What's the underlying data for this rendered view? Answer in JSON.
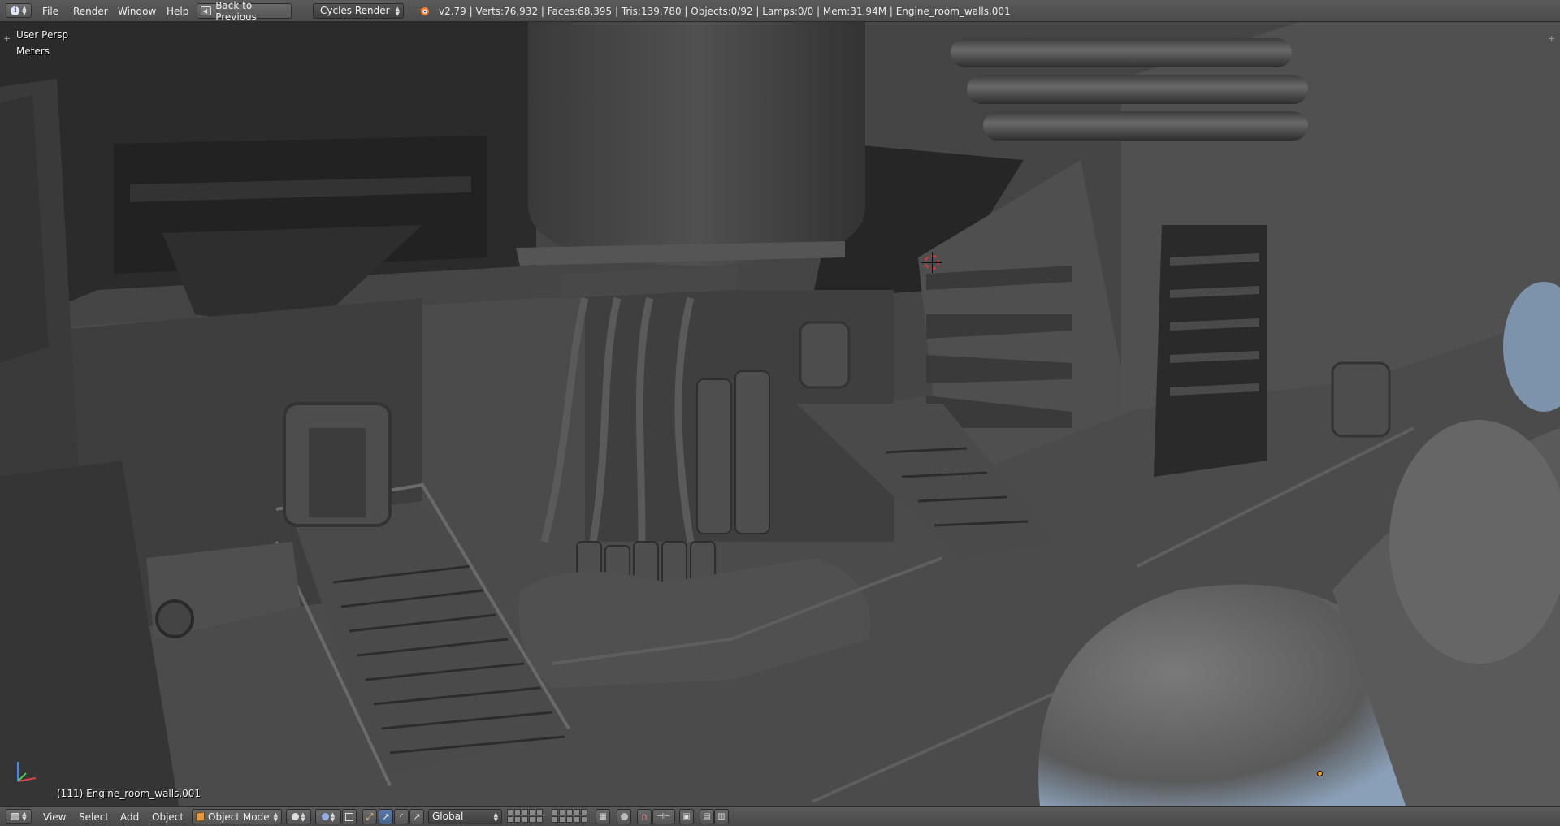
{
  "topbar": {
    "menus": [
      "File",
      "Render",
      "Window",
      "Help"
    ],
    "back_button": "Back to Previous",
    "render_engine": "Cycles Render",
    "stats": "v2.79 | Verts:76,932 | Faces:68,395 | Tris:139,780 | Objects:0/92 | Lamps:0/0 | Mem:31.94M | Engine_room_walls.001"
  },
  "viewport": {
    "view_name": "User Persp",
    "units": "Meters",
    "active_object": "(111) Engine_room_walls.001"
  },
  "bottombar": {
    "menus": [
      "View",
      "Select",
      "Add",
      "Object"
    ],
    "mode": "Object Mode",
    "orientation": "Global"
  },
  "icons": {
    "editor_type": "info-icon",
    "logo": "blender-logo-icon",
    "cursor": "3d-cursor-icon",
    "origin": "object-origin-icon"
  },
  "colors": {
    "header": "#4c4c4c",
    "viewport": "#454545",
    "active_button": "#5778a8",
    "cursor_ring": "#dd3333",
    "origin": "#f7a21a"
  }
}
